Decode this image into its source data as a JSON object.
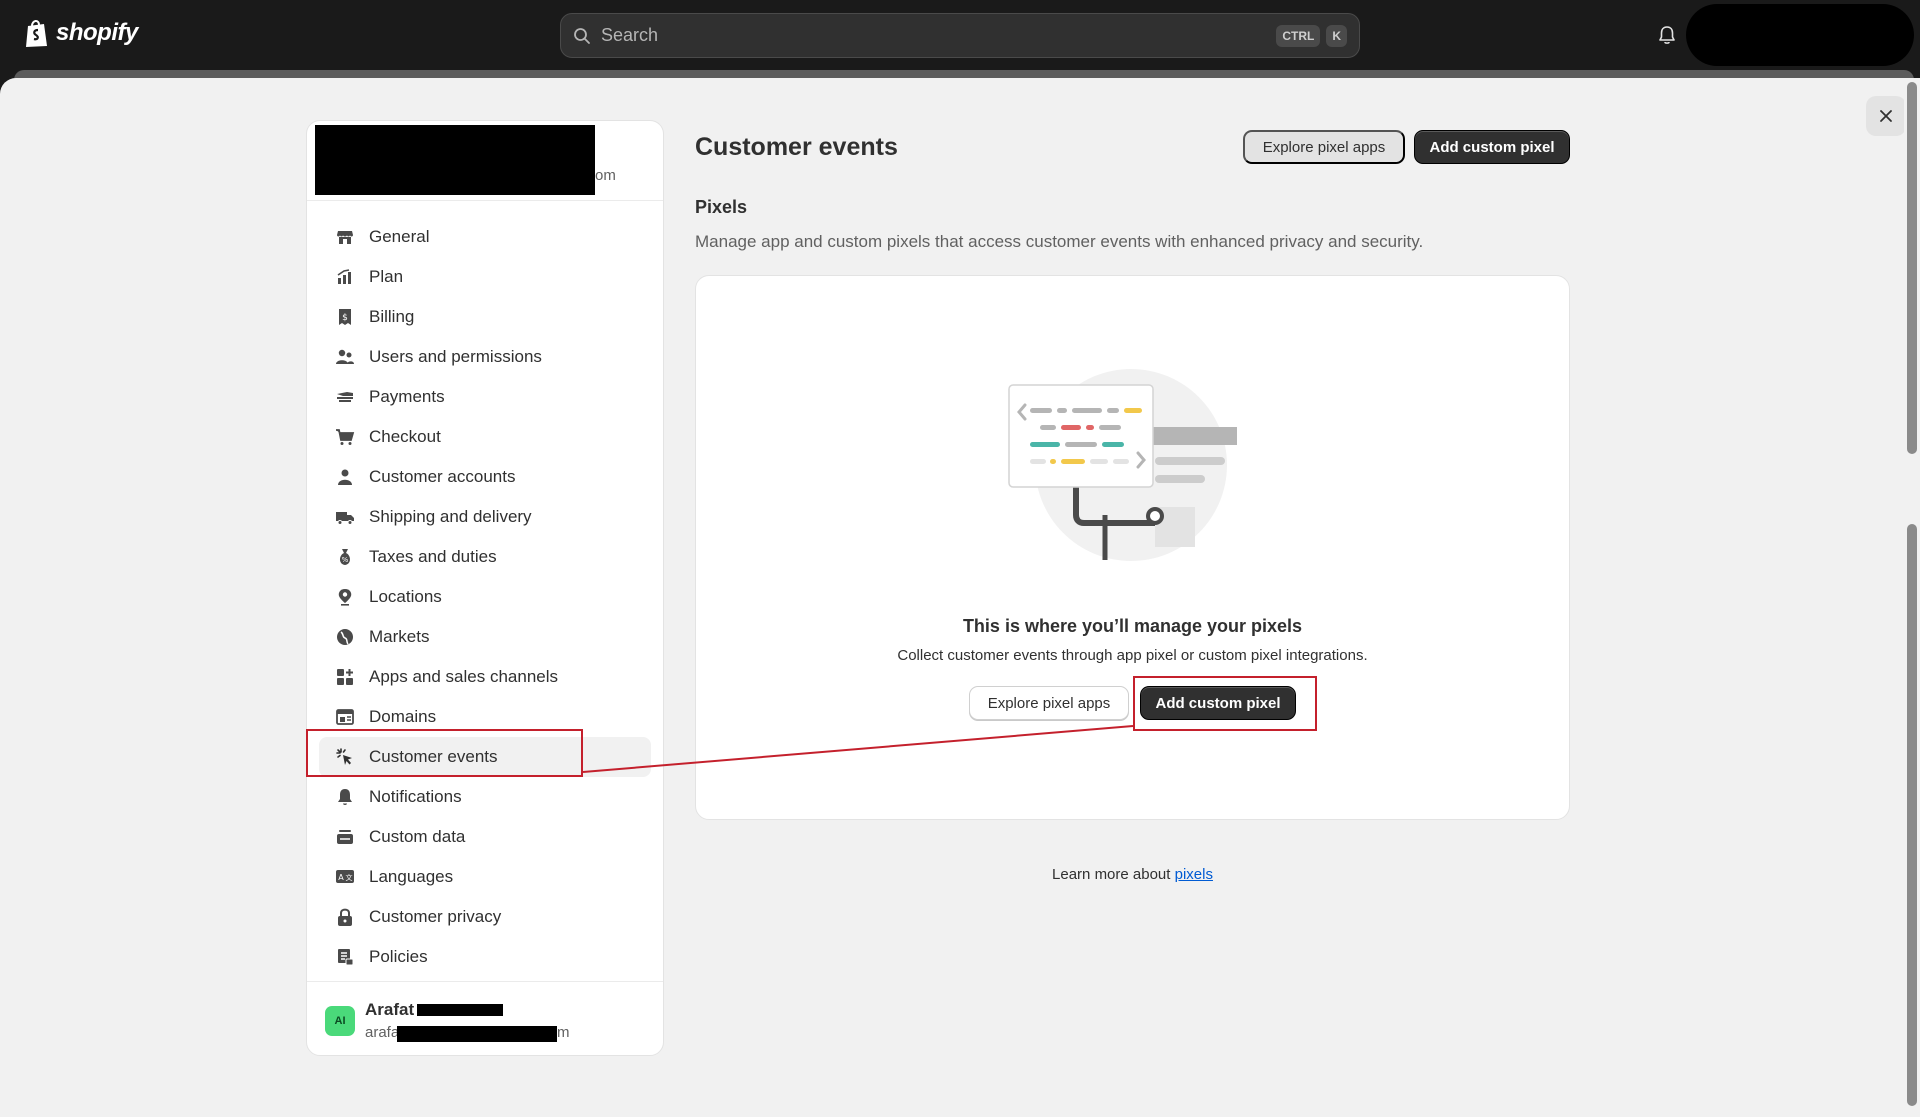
{
  "topbar": {
    "logo_text": "shopify",
    "search_placeholder": "Search",
    "shortcut_ctrl": "CTRL",
    "shortcut_key": "K"
  },
  "store": {
    "domain_suffix": "om"
  },
  "sidebar": {
    "items": [
      {
        "label": "General",
        "icon": "store-icon"
      },
      {
        "label": "Plan",
        "icon": "plan-icon"
      },
      {
        "label": "Billing",
        "icon": "receipt-icon"
      },
      {
        "label": "Users and permissions",
        "icon": "users-icon"
      },
      {
        "label": "Payments",
        "icon": "payments-icon"
      },
      {
        "label": "Checkout",
        "icon": "cart-icon"
      },
      {
        "label": "Customer accounts",
        "icon": "person-icon"
      },
      {
        "label": "Shipping and delivery",
        "icon": "truck-icon"
      },
      {
        "label": "Taxes and duties",
        "icon": "tax-icon"
      },
      {
        "label": "Locations",
        "icon": "location-icon"
      },
      {
        "label": "Markets",
        "icon": "globe-icon"
      },
      {
        "label": "Apps and sales channels",
        "icon": "apps-icon"
      },
      {
        "label": "Domains",
        "icon": "domain-icon"
      },
      {
        "label": "Customer events",
        "icon": "cursor-click-icon",
        "active": true
      },
      {
        "label": "Notifications",
        "icon": "bell-icon"
      },
      {
        "label": "Custom data",
        "icon": "custom-data-icon"
      },
      {
        "label": "Languages",
        "icon": "language-icon"
      },
      {
        "label": "Customer privacy",
        "icon": "lock-icon"
      },
      {
        "label": "Policies",
        "icon": "policy-icon"
      }
    ]
  },
  "user": {
    "initials": "AI",
    "name": "Arafat",
    "email_prefix": "arafa",
    "email_suffix": "m"
  },
  "main": {
    "title": "Customer events",
    "explore_button": "Explore pixel apps",
    "add_button": "Add custom pixel",
    "section_title": "Pixels",
    "section_desc": "Manage app and custom pixels that access customer events with enhanced privacy and security.",
    "empty_title": "This is where you’ll manage your pixels",
    "empty_desc": "Collect customer events through app pixel or custom pixel integrations.",
    "empty_explore_button": "Explore pixel apps",
    "empty_add_button": "Add custom pixel",
    "learn_more_text": "Learn more about ",
    "learn_more_link": "pixels"
  },
  "colors": {
    "annotation": "#c4202c",
    "primary_button": "#303030",
    "link": "#005bd3",
    "avatar": "#4ad97a"
  }
}
